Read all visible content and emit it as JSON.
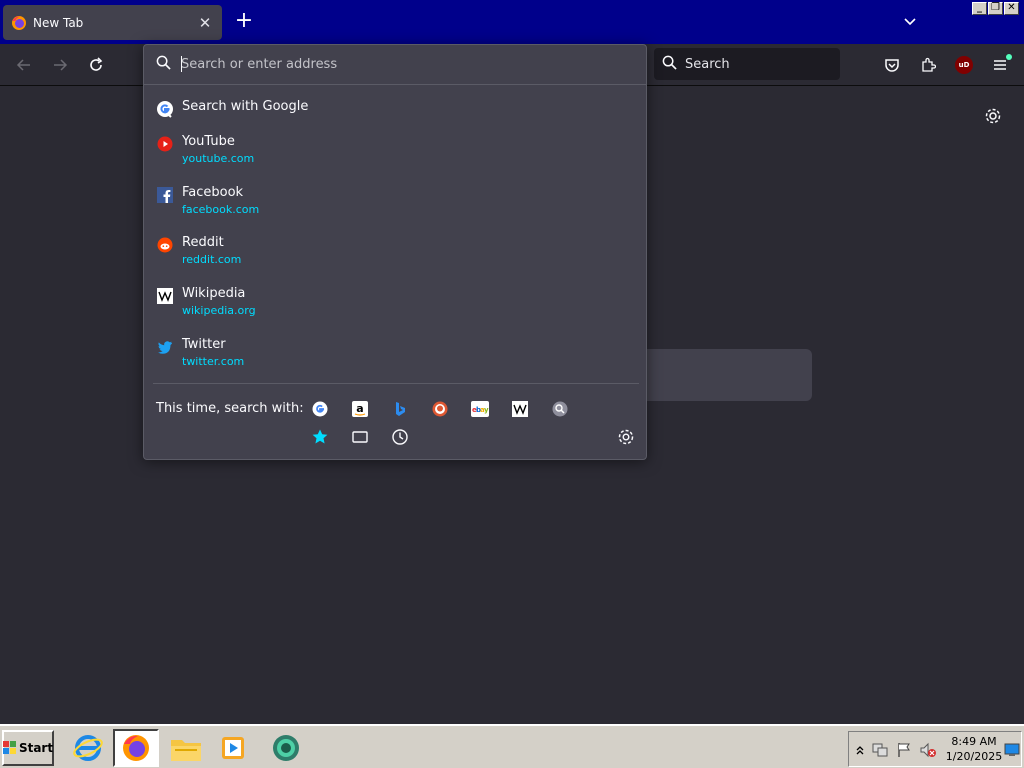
{
  "tab": {
    "title": "New Tab",
    "close_glyph": "✕"
  },
  "titlebar": {
    "new_tab_glyph": "+",
    "min_glyph": "_",
    "restore_glyph": "❐",
    "close_glyph": "✕"
  },
  "toolbar": {
    "search_label": "Search",
    "ublock_label": "uD"
  },
  "urlbar": {
    "placeholder": "Search or enter address",
    "value": ""
  },
  "results": [
    {
      "title": "Search with Google",
      "url": "",
      "icon": "google-icon"
    },
    {
      "title": "YouTube",
      "url": "youtube.com",
      "icon": "youtube-icon"
    },
    {
      "title": "Facebook",
      "url": "facebook.com",
      "icon": "facebook-icon"
    },
    {
      "title": "Reddit",
      "url": "reddit.com",
      "icon": "reddit-icon"
    },
    {
      "title": "Wikipedia",
      "url": "wikipedia.org",
      "icon": "wikipedia-icon"
    },
    {
      "title": "Twitter",
      "url": "twitter.com",
      "icon": "twitter-icon"
    }
  ],
  "one_off": {
    "label": "This time, search with:",
    "engines": [
      "google-icon",
      "amazon-icon",
      "bing-icon",
      "duckduckgo-icon",
      "ebay-icon",
      "wikipedia-icon",
      "search-engine-icon"
    ],
    "modes": [
      "bookmarks-star-icon",
      "tabs-icon",
      "history-icon"
    ]
  },
  "taskbar": {
    "start_label": "Start",
    "clock_time": "8:49 AM",
    "clock_date": "1/20/2025"
  },
  "colors": {
    "accent_link": "#00ddff",
    "panel_bg": "#42414d",
    "page_bg": "#2b2a33",
    "titlebar_bg": "#00008b"
  }
}
